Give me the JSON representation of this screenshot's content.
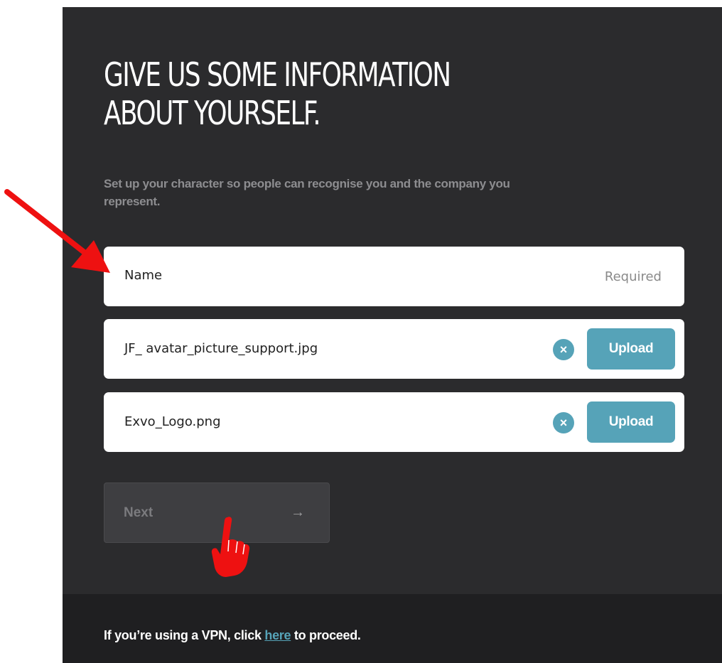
{
  "header": {
    "title": "GIVE US SOME INFORMATION\nABOUT YOURSELF.",
    "subtitle": "Set up your character so people can recognise you and the company you represent."
  },
  "form": {
    "name_field": {
      "label": "Name",
      "value": "",
      "hint": "Required"
    },
    "avatar_field": {
      "filename": "JF_ avatar_picture_support.jpg",
      "clear_label": "×",
      "upload_label": "Upload"
    },
    "logo_field": {
      "filename": "Exvo_Logo.png",
      "clear_label": "×",
      "upload_label": "Upload"
    },
    "next_button": {
      "label": "Next",
      "arrow": "→",
      "enabled": false
    }
  },
  "footer": {
    "text_before": "If you’re using a VPN, click ",
    "link_text": "here",
    "text_after": " to proceed."
  },
  "colors": {
    "panel_bg": "#2b2b2d",
    "footer_bg": "#1f1f21",
    "accent": "#56a3b8",
    "annotation": "#ee1111"
  },
  "annotations": {
    "arrow_icon": "red-arrow-pointing-to-name-field",
    "hand_icon": "red-pointing-hand-at-next-button"
  }
}
